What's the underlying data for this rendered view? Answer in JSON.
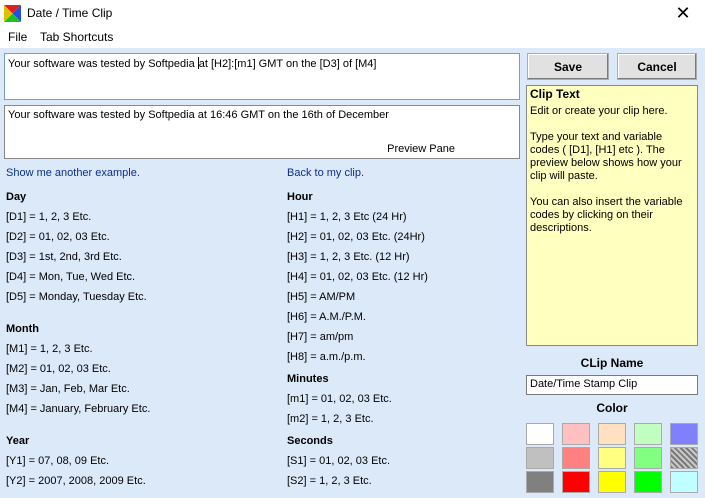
{
  "window": {
    "title": "Date / Time Clip",
    "close_glyph": "✕"
  },
  "menu": {
    "items": [
      "File",
      "Tab Shortcuts"
    ]
  },
  "clip": {
    "text_before_caret": "Your software was tested by Softpedia ",
    "text_after_caret": "at [H2]:[m1] GMT on the [D3] of [M4]"
  },
  "preview": {
    "text": "Your software was tested by Softpedia at 16:46 GMT on the 16th of December",
    "label": "Preview Pane"
  },
  "buttons": {
    "save": "Save",
    "cancel": "Cancel"
  },
  "links": {
    "example": "Show me another example.",
    "back": "Back to my clip."
  },
  "codes": {
    "day": {
      "heading": "Day",
      "items": [
        "[D1] = 1, 2, 3 Etc.",
        "[D2] = 01, 02, 03 Etc.",
        "[D3] = 1st, 2nd, 3rd Etc.",
        "[D4] = Mon, Tue, Wed Etc.",
        "[D5] = Monday, Tuesday Etc."
      ]
    },
    "month": {
      "heading": "Month",
      "items": [
        "[M1] = 1, 2, 3 Etc.",
        "[M2] = 01, 02, 03 Etc.",
        "[M3] = Jan, Feb, Mar Etc.",
        "[M4] = January, February Etc."
      ]
    },
    "year": {
      "heading": "Year",
      "items": [
        "[Y1] = 07, 08, 09 Etc.",
        "[Y2] = 2007, 2008, 2009 Etc."
      ]
    },
    "hour": {
      "heading": "Hour",
      "items": [
        "[H1] =  1, 2, 3 Etc (24 Hr)",
        "[H2] =  01, 02, 03 Etc. (24Hr)",
        "[H3] = 1, 2, 3 Etc. (12 Hr)",
        "[H4] = 01, 02, 03 Etc. (12 Hr)",
        "[H5] = AM/PM",
        "[H6] = A.M./P.M.",
        "[H7] = am/pm",
        "[H8] = a.m./p.m."
      ]
    },
    "minutes": {
      "heading": "Minutes",
      "items": [
        "[m1] = 01, 02, 03 Etc.",
        "[m2] = 1, 2, 3 Etc."
      ]
    },
    "seconds": {
      "heading": "Seconds",
      "items": [
        "[S1] = 01, 02, 03 Etc.",
        "[S2] = 1, 2, 3 Etc."
      ]
    }
  },
  "help": {
    "title": "Clip Text",
    "paragraphs": [
      "Edit or create your clip here.",
      "Type your text and variable codes ( [D1], [H1] etc ). The preview below shows how your clip will paste.",
      "You can also insert the variable codes by clicking on their descriptions."
    ]
  },
  "clipname": {
    "label": "CLip Name",
    "value": "Date/Time Stamp Clip"
  },
  "color": {
    "label": "Color",
    "swatches": [
      [
        "#ffffff",
        "#ffc0c0",
        "#ffe0c0",
        "#c0ffc0",
        "#8080ff"
      ],
      [
        "#c0c0c0",
        "#ff8080",
        "#ffff80",
        "#80ff80",
        "hatch"
      ],
      [
        "#808080",
        "#ff0000",
        "#ffff00",
        "#00ff00",
        "#c0ffff"
      ]
    ]
  }
}
